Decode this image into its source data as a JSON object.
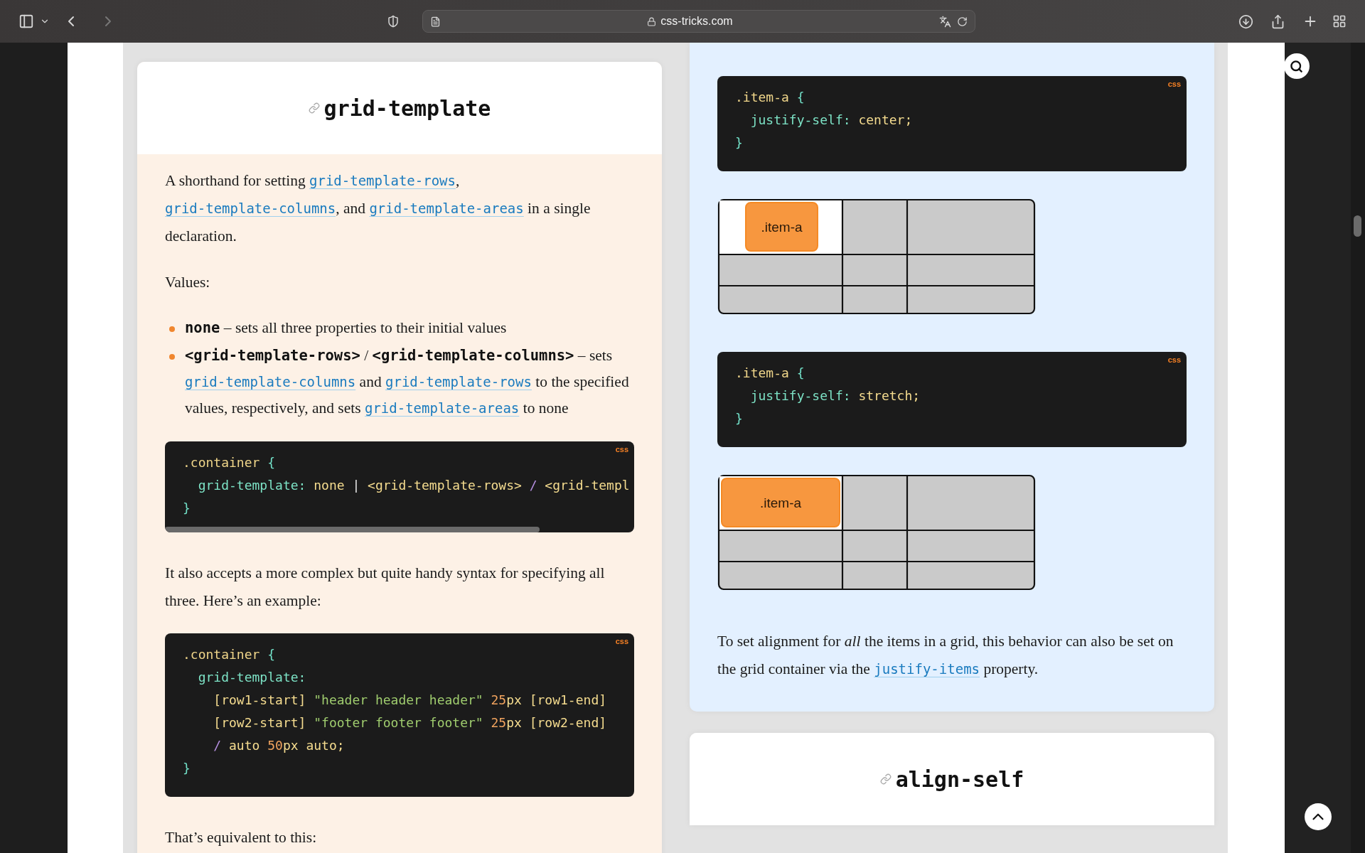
{
  "toolbar": {
    "nav": [
      {
        "kind": "back",
        "disabled": false
      },
      {
        "kind": "forward",
        "disabled": true
      }
    ],
    "address": "css-tricks.com"
  },
  "left_card": {
    "title": "grid-template",
    "content": [
      {
        "kind": "paragraph",
        "segments": [
          {
            "kind": "text",
            "text": "A shorthand for setting "
          },
          {
            "kind": "link",
            "text": "grid-template-rows"
          },
          {
            "kind": "text",
            "text": ", "
          },
          {
            "kind": "link",
            "text": "grid-template-columns"
          },
          {
            "kind": "text",
            "text": ", and "
          },
          {
            "kind": "link",
            "text": "grid-template-areas"
          },
          {
            "kind": "text",
            "text": " in a single declaration."
          }
        ]
      },
      {
        "kind": "paragraph",
        "segments": [
          {
            "kind": "text",
            "text": "Values:"
          }
        ]
      },
      {
        "kind": "list",
        "items": [
          {
            "segments": [
              {
                "kind": "strong",
                "text": "none"
              },
              {
                "kind": "text",
                "text": " – sets all three properties to their initial values"
              }
            ]
          },
          {
            "segments": [
              {
                "kind": "strong",
                "text": "<grid-template-rows>"
              },
              {
                "kind": "text",
                "text": " / "
              },
              {
                "kind": "strong",
                "text": "<grid-template-columns>"
              },
              {
                "kind": "text",
                "text": " – sets "
              },
              {
                "kind": "link",
                "text": "grid-template-columns"
              },
              {
                "kind": "text",
                "text": " and "
              },
              {
                "kind": "link",
                "text": "grid-template-rows"
              },
              {
                "kind": "text",
                "text": " to the specified values, respectively, and sets "
              },
              {
                "kind": "link",
                "text": "grid-template-areas"
              },
              {
                "kind": "text",
                "text": " to none"
              }
            ]
          }
        ]
      },
      {
        "kind": "code",
        "language": "css",
        "overflowing": true,
        "lines": [
          [
            {
              "kind": "selector",
              "text": ".container "
            },
            {
              "kind": "brace",
              "text": "{"
            }
          ],
          [
            {
              "kind": "property",
              "text": "  grid-template:"
            },
            {
              "kind": "value",
              "text": " none"
            },
            {
              "kind": "plain",
              "text": " | "
            },
            {
              "kind": "value",
              "text": "<grid-template-rows>"
            },
            {
              "kind": "operator",
              "text": " / "
            },
            {
              "kind": "value",
              "text": "<grid-templ"
            }
          ],
          [
            {
              "kind": "brace",
              "text": "}"
            }
          ]
        ]
      },
      {
        "kind": "paragraph",
        "segments": [
          {
            "kind": "text",
            "text": "It also accepts a more complex but quite handy syntax for specifying all three. Here’s an example:"
          }
        ]
      },
      {
        "kind": "code",
        "language": "css",
        "overflowing": false,
        "lines": [
          [
            {
              "kind": "selector",
              "text": ".container "
            },
            {
              "kind": "brace",
              "text": "{"
            }
          ],
          [
            {
              "kind": "property",
              "text": "  grid-template:"
            }
          ],
          [
            {
              "kind": "value",
              "text": "    [row1-start] "
            },
            {
              "kind": "string",
              "text": "\"header header header\""
            },
            {
              "kind": "number",
              "text": " 25"
            },
            {
              "kind": "value",
              "text": "px [row1-end]"
            }
          ],
          [
            {
              "kind": "value",
              "text": "    [row2-start] "
            },
            {
              "kind": "string",
              "text": "\"footer footer footer\""
            },
            {
              "kind": "number",
              "text": " 25"
            },
            {
              "kind": "value",
              "text": "px [row2-end]"
            }
          ],
          [
            {
              "kind": "operator",
              "text": "    / "
            },
            {
              "kind": "value",
              "text": "auto "
            },
            {
              "kind": "number",
              "text": "50"
            },
            {
              "kind": "value",
              "text": "px auto;"
            }
          ],
          [
            {
              "kind": "brace",
              "text": "}"
            }
          ]
        ]
      },
      {
        "kind": "paragraph",
        "segments": [
          {
            "kind": "text",
            "text": "That’s equivalent to this:"
          }
        ]
      }
    ]
  },
  "right_card": {
    "content": [
      {
        "kind": "code",
        "language": "css",
        "overflowing": false,
        "lines": [
          [
            {
              "kind": "selector",
              "text": ".item-a "
            },
            {
              "kind": "brace",
              "text": "{"
            }
          ],
          [
            {
              "kind": "property",
              "text": "  justify-self:"
            },
            {
              "kind": "value",
              "text": " center;"
            }
          ],
          [
            {
              "kind": "brace",
              "text": "}"
            }
          ]
        ]
      },
      {
        "kind": "diagram",
        "item": {
          "label": ".item-a",
          "kind": "centered"
        }
      },
      {
        "kind": "code",
        "language": "css",
        "overflowing": false,
        "lines": [
          [
            {
              "kind": "selector",
              "text": ".item-a "
            },
            {
              "kind": "brace",
              "text": "{"
            }
          ],
          [
            {
              "kind": "property",
              "text": "  justify-self:"
            },
            {
              "kind": "value",
              "text": " stretch;"
            }
          ],
          [
            {
              "kind": "brace",
              "text": "}"
            }
          ]
        ]
      },
      {
        "kind": "diagram",
        "item": {
          "label": ".item-a",
          "kind": "stretched"
        }
      },
      {
        "kind": "paragraph",
        "segments": [
          {
            "kind": "text",
            "text": "To set alignment for "
          },
          {
            "kind": "em",
            "text": "all"
          },
          {
            "kind": "text",
            "text": " the items in a grid, this behavior can also be set on the grid container via the "
          },
          {
            "kind": "link",
            "text": "justify-items"
          },
          {
            "kind": "text",
            "text": " property."
          }
        ]
      }
    ]
  },
  "next_card": {
    "title": "align-self"
  }
}
